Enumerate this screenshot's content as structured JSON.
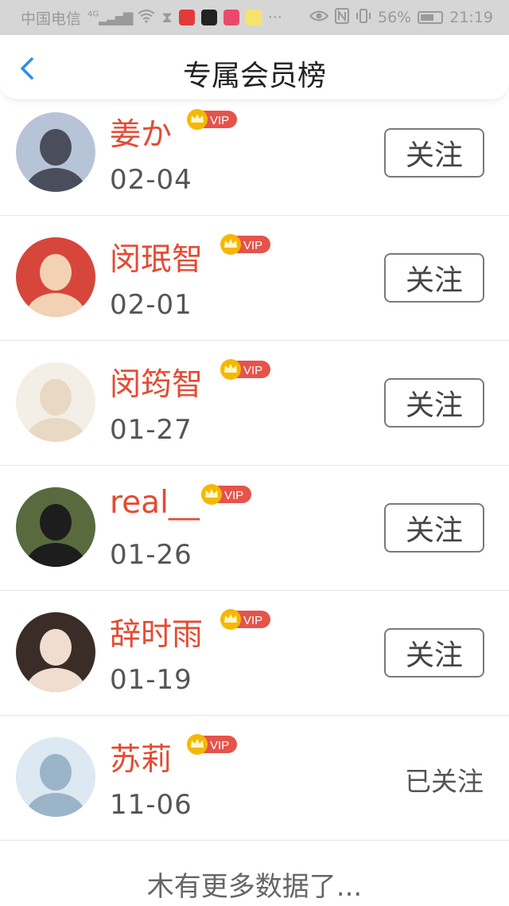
{
  "status_bar": {
    "carrier": "中国电信",
    "network": "4G",
    "more": "···",
    "battery": "56%",
    "time": "21:19"
  },
  "header": {
    "title": "专属会员榜"
  },
  "vip_badge_text": "VIP",
  "follow_label": "关注",
  "followed_label": "已关注",
  "members": [
    {
      "name": "姜か",
      "date": "02-04",
      "followed": false,
      "avatar_colors": [
        "#b7c4d8",
        "#4a4e5c"
      ]
    },
    {
      "name": "闵珉智",
      "date": "02-01",
      "followed": false,
      "avatar_colors": [
        "#d7463a",
        "#f3d2b4"
      ]
    },
    {
      "name": "闵筠智",
      "date": "01-27",
      "followed": false,
      "avatar_colors": [
        "#f4efe6",
        "#e9d8c4"
      ]
    },
    {
      "name": "real__",
      "date": "01-26",
      "followed": false,
      "avatar_colors": [
        "#596a3e",
        "#1d1d1d"
      ]
    },
    {
      "name": "辞时雨",
      "date": "01-19",
      "followed": false,
      "avatar_colors": [
        "#3a2c26",
        "#f0ddd0"
      ]
    },
    {
      "name": "苏莉",
      "date": "11-06",
      "followed": true,
      "avatar_colors": [
        "#dce8f2",
        "#9bb4c8"
      ]
    }
  ],
  "footer": {
    "text": "木有更多数据了..."
  },
  "colors": {
    "accent_name": "#e44b32",
    "vip_badge": "#e5534b",
    "crown": "#f5b800",
    "back_icon": "#2c8fe6"
  }
}
